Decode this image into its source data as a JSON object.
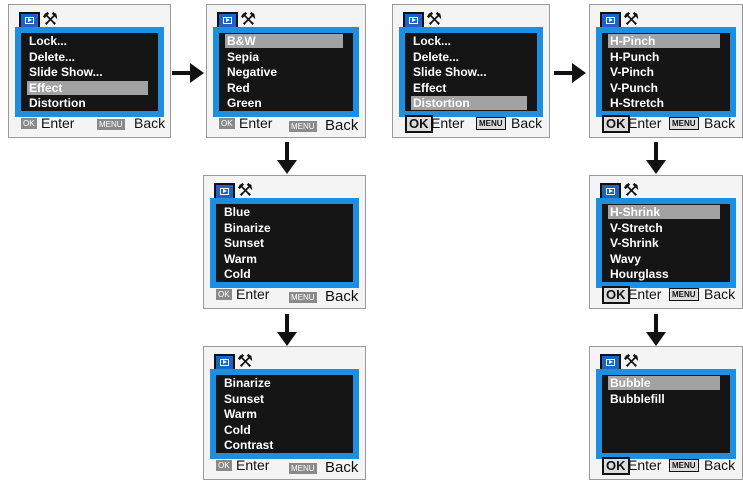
{
  "panels": [
    {
      "items": [
        "Lock...",
        "Delete...",
        "Slide Show...",
        "Effect",
        "Distortion"
      ],
      "selected": 3,
      "ok": "OK",
      "enter": "Enter",
      "menu": "MENU",
      "back": "Back"
    },
    {
      "items": [
        "B&W",
        "Sepia",
        "Negative",
        "Red",
        "Green"
      ],
      "selected": 0,
      "ok": "OK",
      "enter": "Enter",
      "menu": "MENU",
      "back": "Back"
    },
    {
      "items": [
        "Blue",
        "Binarize",
        "Sunset",
        "Warm",
        "Cold"
      ],
      "selected": -1,
      "ok": "OK",
      "enter": "Enter",
      "menu": "MENU",
      "back": "Back"
    },
    {
      "items": [
        "Binarize",
        "Sunset",
        "Warm",
        "Cold",
        "Contrast"
      ],
      "selected": -1,
      "ok": "OK",
      "enter": "Enter",
      "menu": "MENU",
      "back": "Back"
    },
    {
      "items": [
        "Lock...",
        "Delete...",
        "Slide Show...",
        "Effect",
        "Distortion"
      ],
      "selected": 4,
      "ok": "OK",
      "enter": "Enter",
      "menu": "MENU",
      "back": "Back"
    },
    {
      "items": [
        "H-Pinch",
        "H-Punch",
        "V-Pinch",
        "V-Punch",
        "H-Stretch"
      ],
      "selected": 0,
      "ok": "OK",
      "enter": "Enter",
      "menu": "MENU",
      "back": "Back"
    },
    {
      "items": [
        "H-Shrink",
        "V-Stretch",
        "V-Shrink",
        "Wavy",
        "Hourglass"
      ],
      "selected": 0,
      "ok": "OK",
      "enter": "Enter",
      "menu": "MENU",
      "back": "Back"
    },
    {
      "items": [
        "Bubble",
        "Bubblefill"
      ],
      "selected": 0,
      "ok": "OK",
      "enter": "Enter",
      "menu": "MENU",
      "back": "Back"
    }
  ],
  "icons": {
    "playback_tab": "playback-icon",
    "setup_tab": "wrench-icon",
    "arrow": "arrow-icon"
  },
  "colors": {
    "screen_border": "#1e8ee0",
    "screen_bg": "#151515",
    "selection": "#a2a2a2",
    "text": "#ffffff"
  }
}
